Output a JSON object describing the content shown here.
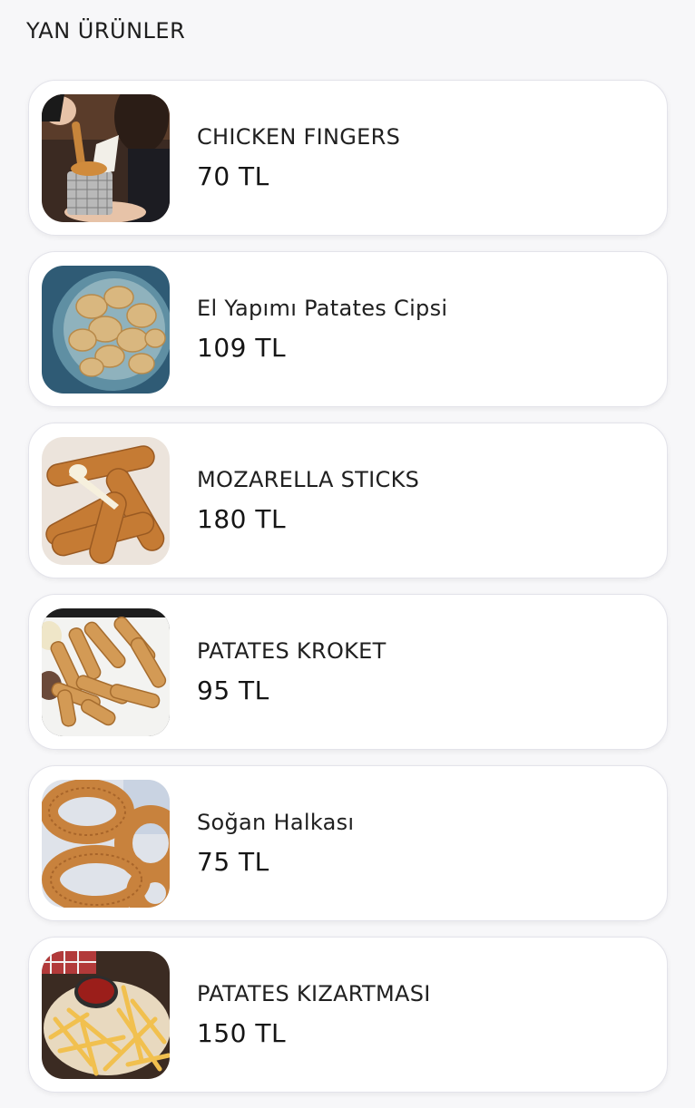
{
  "section": {
    "title": "YAN ÜRÜNLER"
  },
  "items": [
    {
      "name": "CHICKEN FINGERS",
      "price": "70 TL",
      "image": "chicken-fingers-photo"
    },
    {
      "name": "El Yapımı Patates Cipsi",
      "price": "109 TL",
      "image": "potato-chips-photo"
    },
    {
      "name": "MOZARELLA STICKS",
      "price": "180 TL",
      "image": "mozzarella-sticks-photo"
    },
    {
      "name": "PATATES KROKET",
      "price": "95 TL",
      "image": "potato-croquette-photo"
    },
    {
      "name": "Soğan Halkası",
      "price": "75 TL",
      "image": "onion-rings-photo"
    },
    {
      "name": "PATATES KIZARTMASI",
      "price": "150 TL",
      "image": "french-fries-photo"
    }
  ]
}
